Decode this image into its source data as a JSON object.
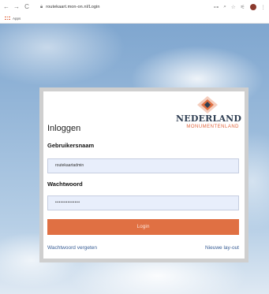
{
  "browser": {
    "url": "routekaart.mon-on.nl/Login",
    "bookmarks_label": "Apps"
  },
  "logo": {
    "title": "NEDERLAND",
    "subtitle": "MONUMENTENLAND",
    "brand_color": "#e0663f",
    "title_color": "#2f3e52"
  },
  "form": {
    "heading": "Inloggen",
    "username_label": "Gebruikersnaam",
    "username_value": "routekaartadmin",
    "password_label": "Wachtwoord",
    "password_value": "••••••••••••••",
    "login_label": "Login",
    "forgot_link": "Wachtwoord vergeten",
    "layout_link": "Nieuwe lay-out"
  },
  "colors": {
    "button": "#e07043",
    "link": "#3a5f96",
    "input_bg": "#e8eefb"
  }
}
